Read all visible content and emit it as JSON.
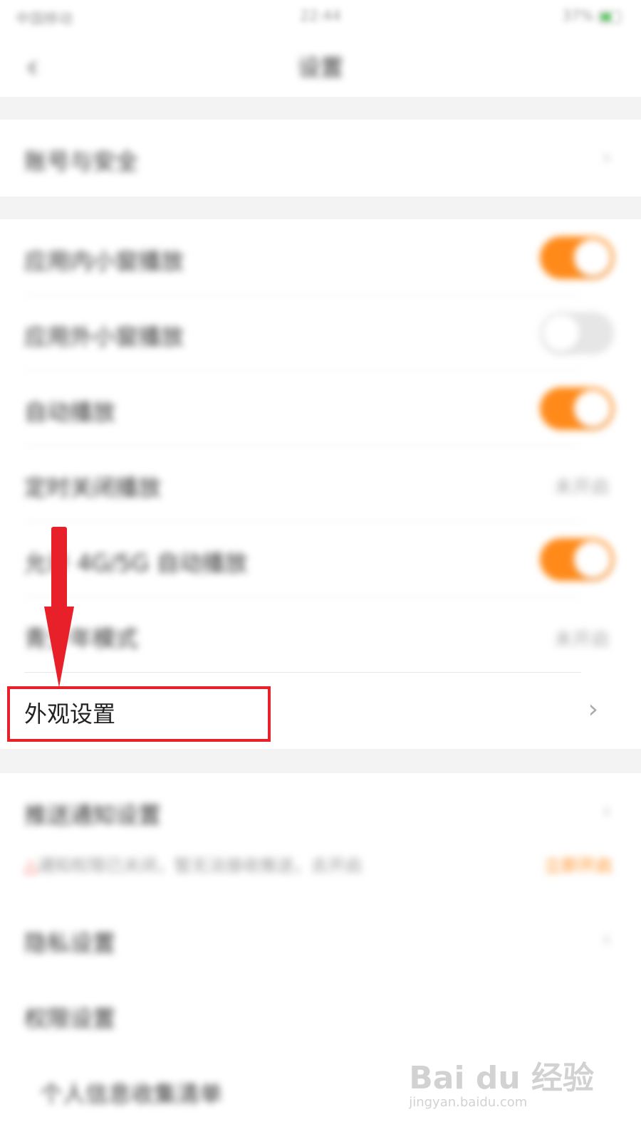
{
  "status_bar": {
    "carrier": "中国移动",
    "time": "22:44",
    "battery": "37%"
  },
  "header": {
    "back_icon": "back-chevron-icon",
    "title": "设置"
  },
  "sections": {
    "account": {
      "label": "账号与安全"
    },
    "playback": {
      "items": [
        {
          "label": "应用内小窗播放",
          "toggle": "on"
        },
        {
          "label": "应用外小窗播放",
          "toggle": "off"
        },
        {
          "label": "自动播放",
          "toggle": "on"
        },
        {
          "label": "定时关闭播放",
          "value": "未开启"
        },
        {
          "label": "允许 4G/5G 自动播放",
          "toggle": "on"
        },
        {
          "label": "青少年模式",
          "value": "未开启"
        },
        {
          "label": "外观设置"
        }
      ]
    },
    "notifications": {
      "label": "推送通知设置",
      "desc": "通知权限已关闭，暂无法接收推送，去开启",
      "action": "立即开启"
    },
    "privacy": {
      "label": "隐私设置"
    },
    "permissions": {
      "label": "权限设置"
    },
    "personal_info": {
      "label": "个人信息收集清单"
    }
  },
  "watermark": {
    "brand": "Bai du 经验",
    "url": "jingyan.baidu.com"
  },
  "colors": {
    "accent": "#ff8a1a",
    "highlight": "#e8202a",
    "arrow": "#e8202a",
    "toggle_off": "#e6e6e6"
  }
}
